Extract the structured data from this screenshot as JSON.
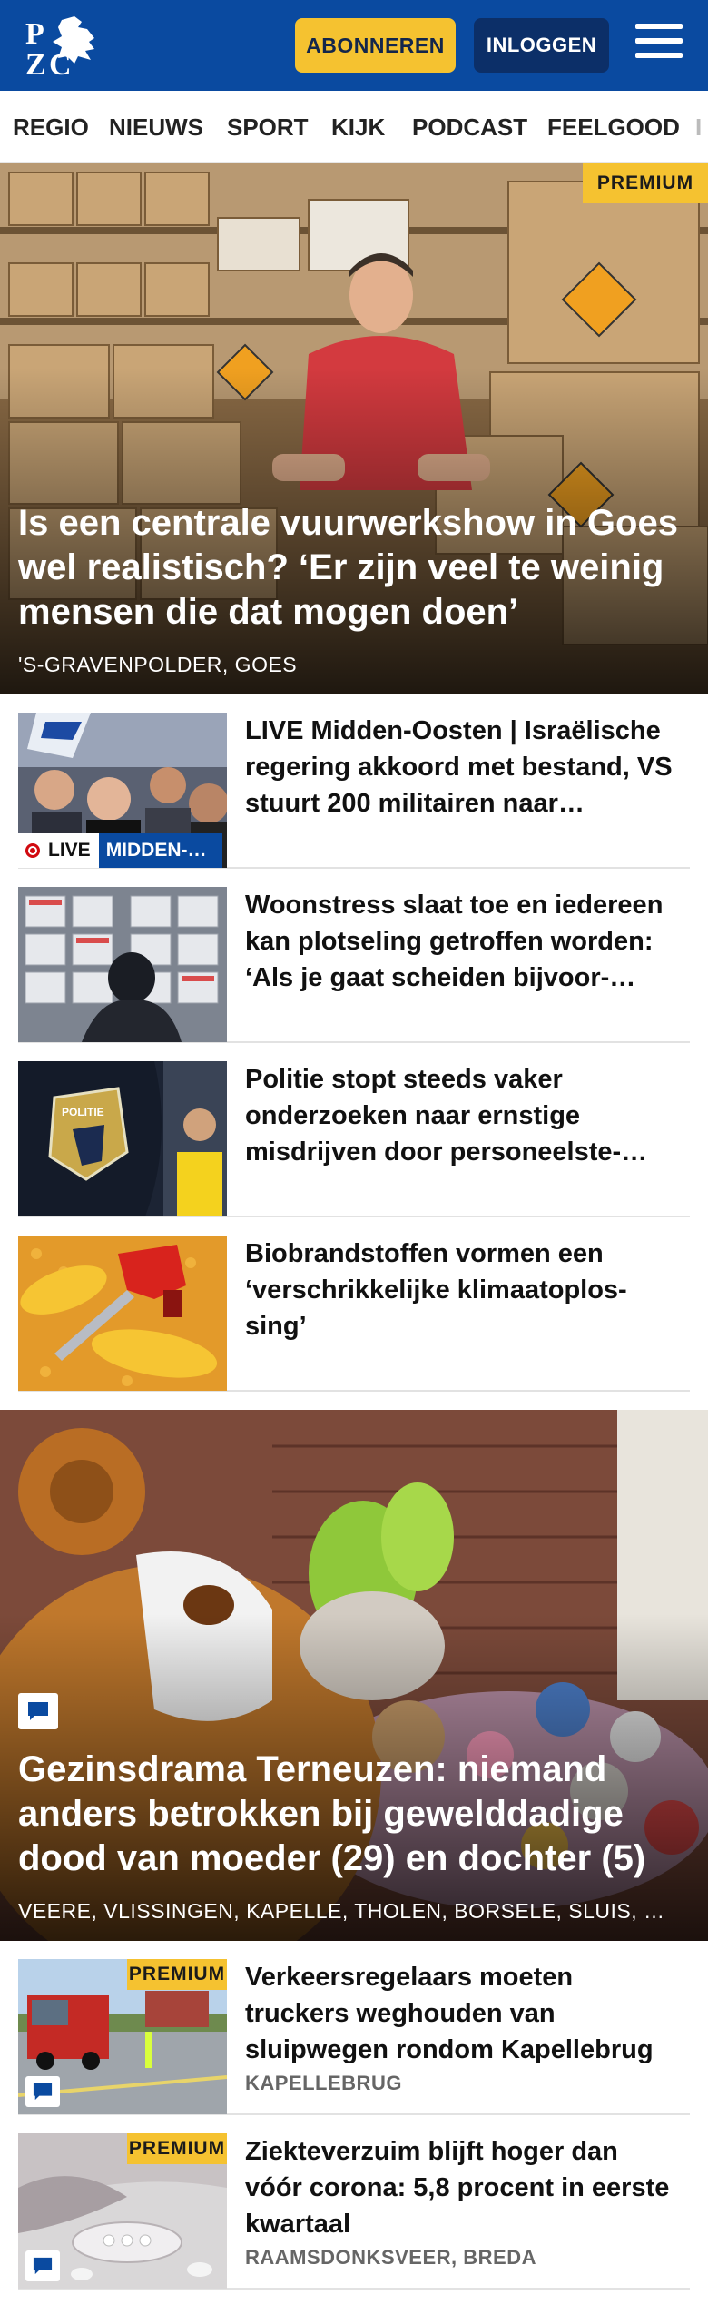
{
  "header": {
    "logo_text": "PZC",
    "subscribe_label": "ABONNEREN",
    "login_label": "INLOGGEN",
    "menu_icon": "hamburger-menu-icon"
  },
  "nav": {
    "items": [
      "REGIO",
      "NIEUWS",
      "SPORT",
      "KIJK",
      "PODCAST",
      "FEELGOOD",
      "I"
    ]
  },
  "hero1": {
    "badge": "PREMIUM",
    "title": "Is een centrale vuurwerkshow in Goes wel realistisch? ‘Er zijn veel te weinig mensen die dat mogen doen’",
    "location": "'S-GRAVENPOLDER, GOES"
  },
  "articles1": [
    {
      "title": "LIVE Midden-Oosten | Israëlische regering akkoord met bestand, VS stuurt 200 militairen naar…",
      "live_label": "LIVE",
      "category": "MIDDEN-…"
    },
    {
      "title": "Woonstress slaat toe en iedereen kan plotseling getroffen worden: ‘Als je gaat scheiden bijvoor-…"
    },
    {
      "title": "Politie stopt steeds vaker onderzoeken naar ernstige misdrijven door personeelste-…"
    },
    {
      "title": "Biobrandstoffen vormen een ‘verschrikkelijke klimaatoplos-sing’"
    }
  ],
  "hero2": {
    "title": "Gezinsdrama Terneuzen: niemand anders betrokken bij gewelddadige dood van moeder (29) en dochter (5)",
    "location": "VEERE, VLISSINGEN, KAPELLE, THOLEN, BORSELE, SLUIS, …"
  },
  "articles2": [
    {
      "title": "Verkeersregelaars moeten truckers weghouden van sluipwegen rondom Kapellebrug",
      "location": "KAPELLEBRUG",
      "badge": "PREMIUM"
    },
    {
      "title": "Ziekteverzuim blijft hoger dan vóór corona: 5,8 procent in eerste kwartaal",
      "location": "RAAMSDONKSVEER, BREDA",
      "badge": "PREMIUM"
    }
  ],
  "colors": {
    "brand_blue": "#0a4aa0",
    "accent_yellow": "#f5c230",
    "login_navy": "#0c2f68",
    "live_red": "#d10a10"
  }
}
